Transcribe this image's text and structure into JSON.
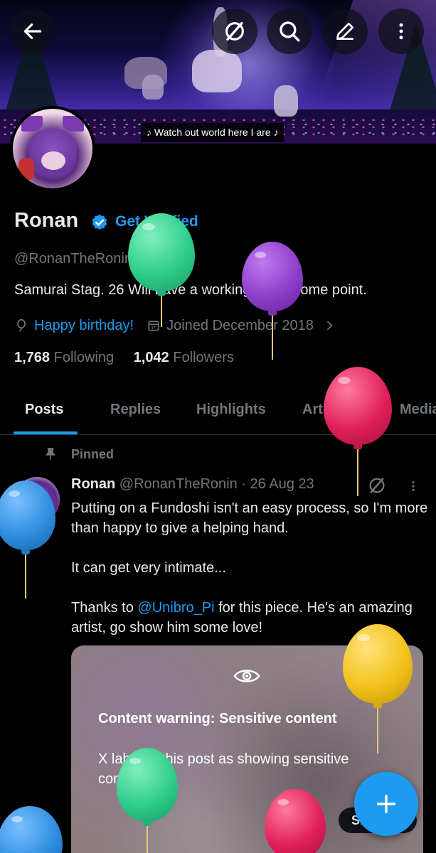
{
  "banner": {
    "caption": "♪ Watch out world here I are ♪"
  },
  "top_bar": {
    "icons": [
      "back-arrow-icon",
      "grok-icon",
      "search-icon",
      "edit-icon",
      "more-vertical-icon"
    ]
  },
  "profile": {
    "name": "Ronan",
    "verify_label": "Get Verified",
    "handle": "@RonanTheRonin",
    "bio": "Samurai Stag. 26  Will have a working bio at some point.",
    "birthday": "Happy birthday!",
    "joined": "Joined December 2018",
    "following_count": "1,768",
    "following_label": "Following",
    "followers_count": "1,042",
    "followers_label": "Followers"
  },
  "tabs": [
    "Posts",
    "Replies",
    "Highlights",
    "Articles",
    "Media"
  ],
  "post": {
    "pinned_label": "Pinned",
    "author_name": "Ronan",
    "author_handle": "@RonanTheRonin",
    "separator": "·",
    "date": "26 Aug 23",
    "line1": "Putting on a Fundoshi isn't an easy process, so I'm more than happy to give a helping hand.",
    "line2": "It can get very intimate...",
    "line3_prefix": "Thanks to ",
    "mention": "@Unibro_Pi",
    "line3_suffix": " for this piece. He's an amazing artist, go show him some love!",
    "media": {
      "warning_title": "Content warning: Sensitive content",
      "warning_body": "X labeled this post as showing sensitive content.",
      "show_label": "Show"
    }
  },
  "colors": {
    "accent": "#1d9bf0",
    "text_primary": "#e7e9ea",
    "text_secondary": "#71767b",
    "background": "#000000",
    "balloon_green": "#2ecc8a",
    "balloon_purple": "#8e3ec9",
    "balloon_red": "#e0205a",
    "balloon_blue": "#2f8ee0",
    "balloon_yellow": "#f2c21b"
  }
}
